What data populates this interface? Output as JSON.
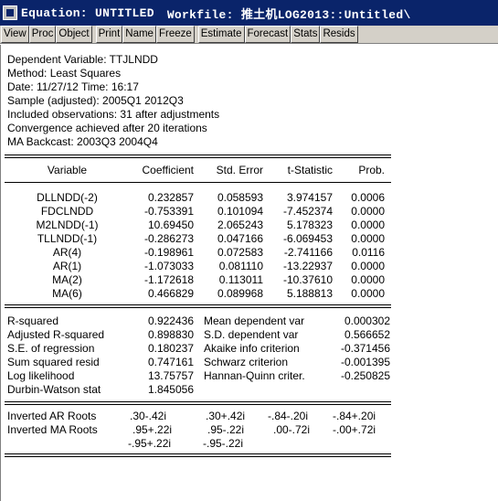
{
  "window": {
    "title": "Equation: UNTITLED",
    "workfile": "Workfile: 推土机LOG2013::Untitled\\"
  },
  "toolbar": {
    "buttons": [
      "View",
      "Proc",
      "Object",
      "Print",
      "Name",
      "Freeze",
      "Estimate",
      "Forecast",
      "Stats",
      "Resids"
    ]
  },
  "header_lines": [
    "Dependent Variable: TTJLNDD",
    "Method: Least Squares",
    "Date: 11/27/12   Time: 16:17",
    "Sample (adjusted): 2005Q1 2012Q3",
    "Included observations: 31 after adjustments",
    "Convergence achieved after 20 iterations",
    "MA Backcast: 2003Q3 2004Q4"
  ],
  "coef_table": {
    "columns": [
      "Variable",
      "Coefficient",
      "Std. Error",
      "t-Statistic",
      "Prob."
    ],
    "rows": [
      [
        "DLLNDD(-2)",
        "0.232857",
        "0.058593",
        "3.974157",
        "0.0006"
      ],
      [
        "FDCLNDD",
        "-0.753391",
        "0.101094",
        "-7.452374",
        "0.0000"
      ],
      [
        "M2LNDD(-1)",
        "10.69450",
        "2.065243",
        "5.178323",
        "0.0000"
      ],
      [
        "TLLNDD(-1)",
        "-0.286273",
        "0.047166",
        "-6.069453",
        "0.0000"
      ],
      [
        "AR(4)",
        "-0.198961",
        "0.072583",
        "-2.741166",
        "0.0116"
      ],
      [
        "AR(1)",
        "-1.073033",
        "0.081110",
        "-13.22937",
        "0.0000"
      ],
      [
        "MA(2)",
        "-1.172618",
        "0.113011",
        "-10.37610",
        "0.0000"
      ],
      [
        "MA(6)",
        "0.466829",
        "0.089968",
        "5.188813",
        "0.0000"
      ]
    ]
  },
  "stats_table": {
    "rows": [
      [
        "R-squared",
        "0.922436",
        "Mean dependent var",
        "0.000302"
      ],
      [
        "Adjusted R-squared",
        "0.898830",
        "S.D. dependent var",
        "0.566652"
      ],
      [
        "S.E. of regression",
        "0.180237",
        "Akaike info criterion",
        "-0.371456"
      ],
      [
        "Sum squared resid",
        "0.747161",
        "Schwarz criterion",
        "-0.001395"
      ],
      [
        "Log likelihood",
        "13.75757",
        "Hannan-Quinn criter.",
        "-0.250825"
      ],
      [
        "Durbin-Watson stat",
        "1.845056",
        "",
        ""
      ]
    ]
  },
  "roots": {
    "ar_label": "Inverted AR Roots",
    "ar_values": [
      ".30-.42i",
      ".30+.42i",
      "-.84-.20i",
      "-.84+.20i"
    ],
    "ma_label": "Inverted MA Roots",
    "ma_values": [
      ".95+.22i",
      ".95-.22i",
      ".00-.72i",
      "-.00+.72i"
    ],
    "ma_extra": [
      "-.95+.22i",
      "-.95-.22i"
    ]
  }
}
